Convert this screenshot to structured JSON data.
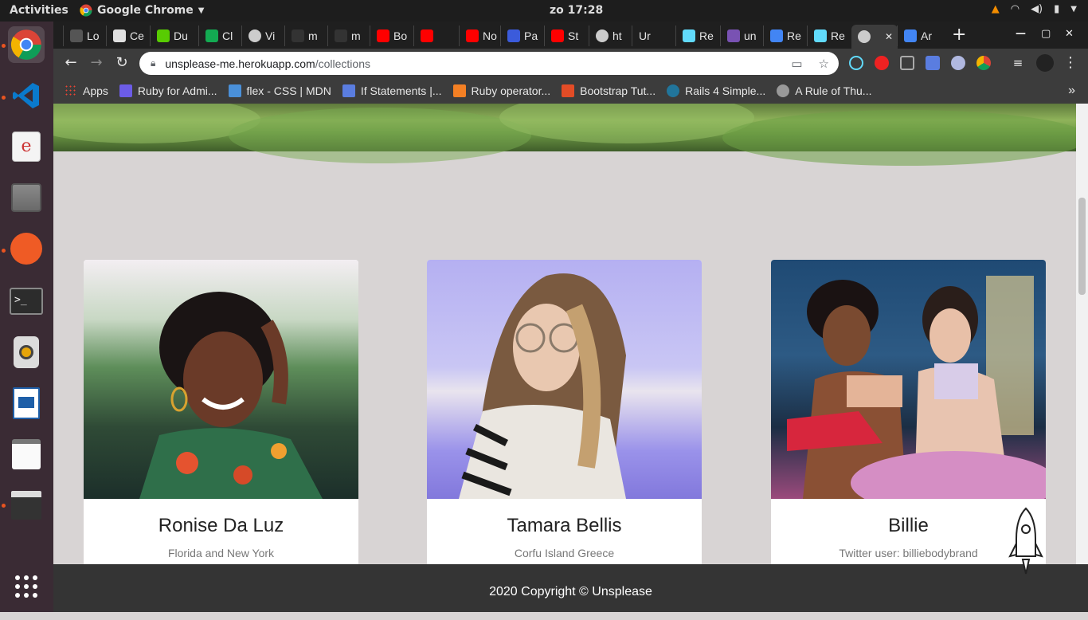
{
  "system": {
    "activities": "Activities",
    "app_name": "Google Chrome",
    "clock": "zo 17:28"
  },
  "tabs": [
    {
      "label": "Lo",
      "icon": "generic-icon",
      "color": "#555555"
    },
    {
      "label": "Ce",
      "icon": "doc-icon",
      "color": "#e0e0e0"
    },
    {
      "label": "Du",
      "icon": "duolingo-icon",
      "color": "#58cc02"
    },
    {
      "label": "Cl",
      "icon": "mongodb-icon",
      "color": "#13aa52"
    },
    {
      "label": "Vi",
      "icon": "globe-icon",
      "color": "#cccccc"
    },
    {
      "label": "m",
      "icon": "github-icon",
      "color": "#333333"
    },
    {
      "label": "m",
      "icon": "github-icon",
      "color": "#333333"
    },
    {
      "label": "Bo",
      "icon": "youtube-icon",
      "color": "#ff0000"
    },
    {
      "label": "",
      "icon": "youtube-icon",
      "color": "#ff0000"
    },
    {
      "label": "No",
      "icon": "youtube-icon",
      "color": "#ff0000"
    },
    {
      "label": "Pa",
      "icon": "generic-icon",
      "color": "#3b5bdb"
    },
    {
      "label": "St",
      "icon": "youtube-icon",
      "color": "#ff0000"
    },
    {
      "label": "ht",
      "icon": "globe-icon",
      "color": "#cccccc"
    },
    {
      "label": "Ur",
      "icon": "none",
      "color": "#1f1f1f"
    },
    {
      "label": "Re",
      "icon": "react-icon",
      "color": "#61dafb"
    },
    {
      "label": "un",
      "icon": "heroku-icon",
      "color": "#7952b3"
    },
    {
      "label": "Re",
      "icon": "google-icon",
      "color": "#4285f4"
    },
    {
      "label": "Re",
      "icon": "react-icon",
      "color": "#61dafb"
    },
    {
      "label": "",
      "icon": "globe-icon",
      "color": "#cccccc",
      "active": true
    },
    {
      "label": "Ar",
      "icon": "google-icon",
      "color": "#4285f4"
    }
  ],
  "address_bar": {
    "domain": "unsplease-me.herokuapp.com",
    "path": "/collections"
  },
  "bookmarks": [
    {
      "label": "Apps",
      "icon": "apps-grid-icon"
    },
    {
      "label": "Ruby for Admi...",
      "icon": "rb-icon"
    },
    {
      "label": "flex - CSS | MDN",
      "icon": "mdn-icon"
    },
    {
      "label": "If Statements |...",
      "icon": "bookmark-icon"
    },
    {
      "label": "Ruby operator...",
      "icon": "stackoverflow-icon"
    },
    {
      "label": "Bootstrap Tut...",
      "icon": "w3-icon"
    },
    {
      "label": "Rails 4 Simple...",
      "icon": "wordpress-icon"
    },
    {
      "label": "A Rule of Thu...",
      "icon": "globe-icon"
    }
  ],
  "bookmarks_more": "»",
  "cards": [
    {
      "name": "Ronise Da Luz",
      "description": "Florida and New York"
    },
    {
      "name": "Tamara Bellis",
      "description": "Corfu Island Greece"
    },
    {
      "name": "Billie",
      "description": "Twitter user: billiebodybrand"
    }
  ],
  "footer": {
    "text": "2020 Copyright © Unsplease"
  },
  "colors": {
    "page_bg": "#d8d4d4",
    "footer_bg": "#343434",
    "dock_bg": "#3a2b34",
    "accent_dot": "#e95420"
  }
}
